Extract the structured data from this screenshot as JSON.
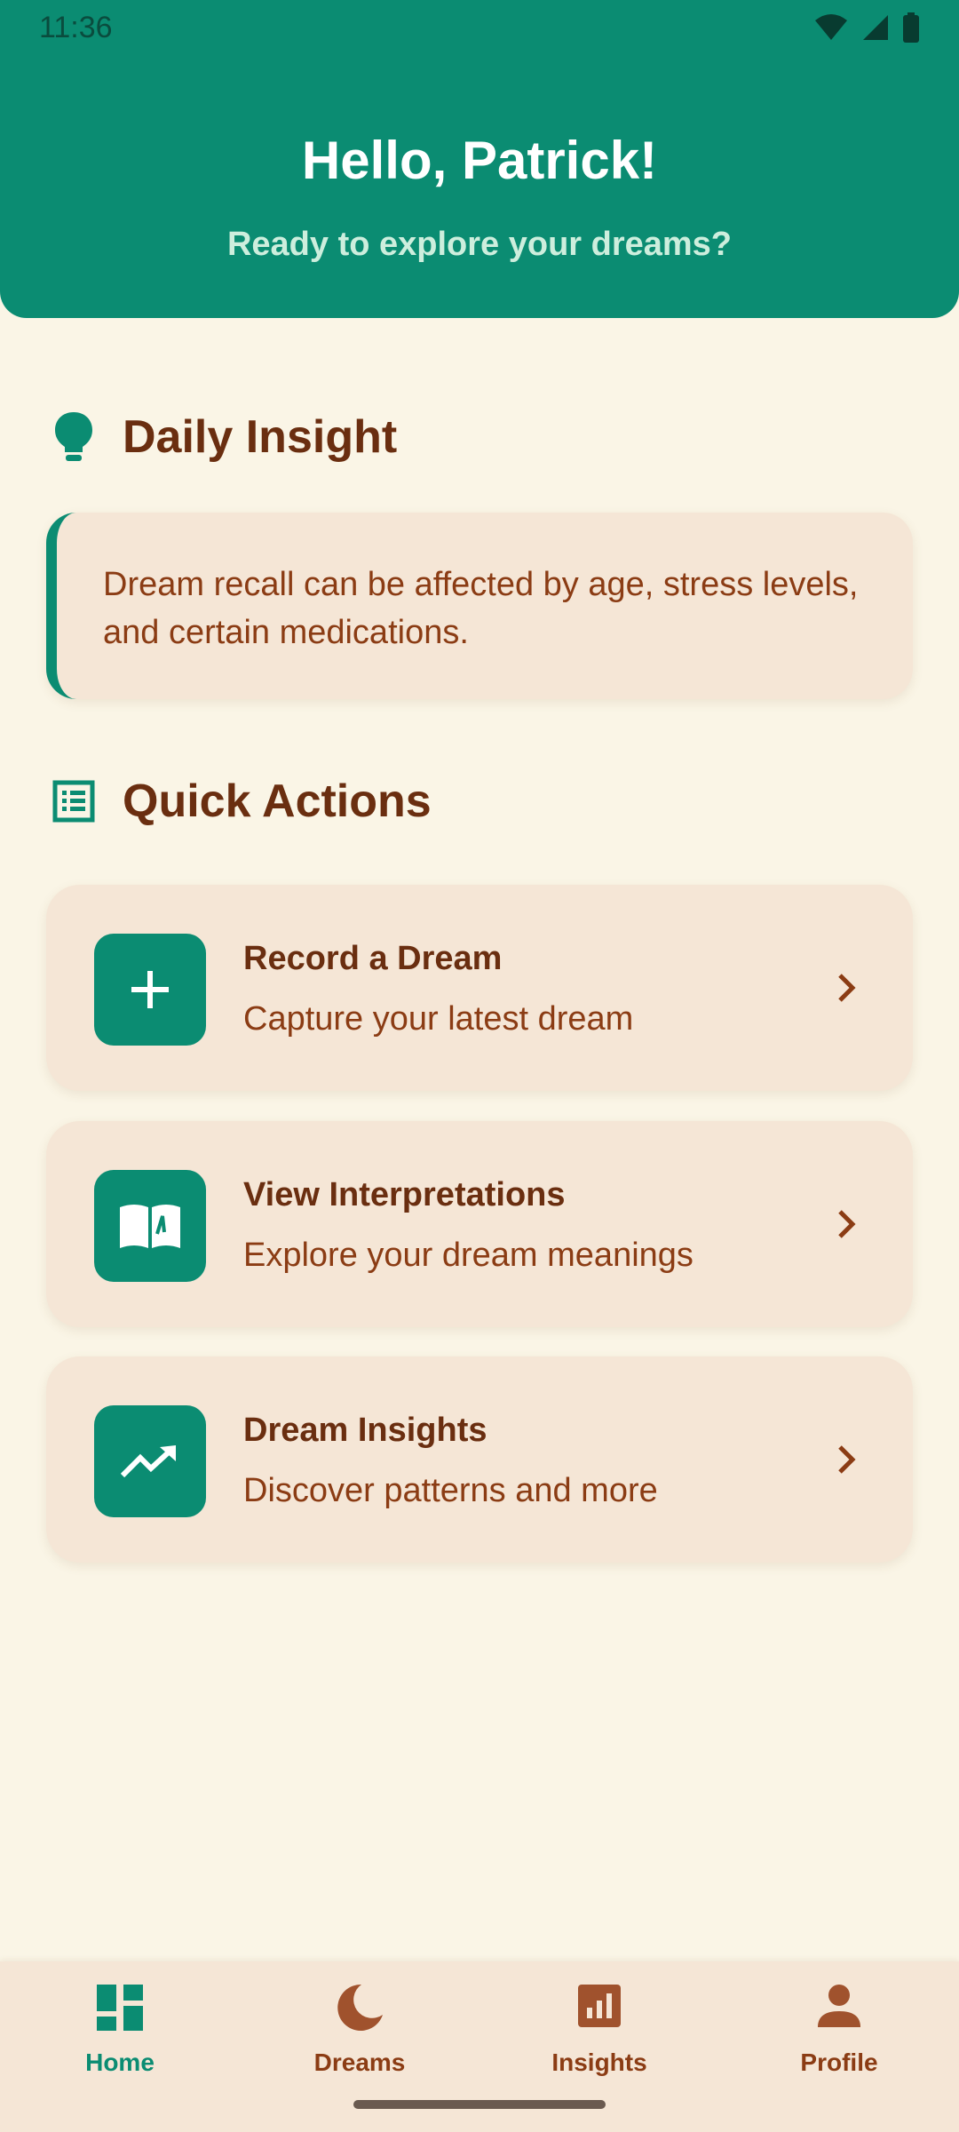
{
  "status_bar": {
    "time": "11:36",
    "icons": [
      "wifi-icon",
      "signal-icon",
      "battery-icon"
    ]
  },
  "header": {
    "greeting": "Hello, Patrick!",
    "subtitle": "Ready to explore your dreams?"
  },
  "daily_insight": {
    "title": "Daily Insight",
    "icon": "lightbulb-icon",
    "text": "Dream recall can be affected by age, stress levels, and certain medications."
  },
  "quick_actions": {
    "title": "Quick Actions",
    "icon": "list-icon",
    "items": [
      {
        "title": "Record a Dream",
        "subtitle": "Capture your latest dream",
        "icon": "plus-icon"
      },
      {
        "title": "View Interpretations",
        "subtitle": "Explore your dream meanings",
        "icon": "book-icon"
      },
      {
        "title": "Dream Insights",
        "subtitle": "Discover patterns and more",
        "icon": "trending-up-icon"
      }
    ]
  },
  "bottom_nav": {
    "items": [
      {
        "label": "Home",
        "icon": "dashboard-icon",
        "active": true
      },
      {
        "label": "Dreams",
        "icon": "moon-icon",
        "active": false
      },
      {
        "label": "Insights",
        "icon": "bar-chart-icon",
        "active": false
      },
      {
        "label": "Profile",
        "icon": "person-icon",
        "active": false
      }
    ]
  },
  "colors": {
    "primary": "#0b8c72",
    "background": "#faf5e6",
    "card": "#f5e6d6",
    "text_dark": "#6a2e10",
    "text_brown": "#8b3c14"
  }
}
